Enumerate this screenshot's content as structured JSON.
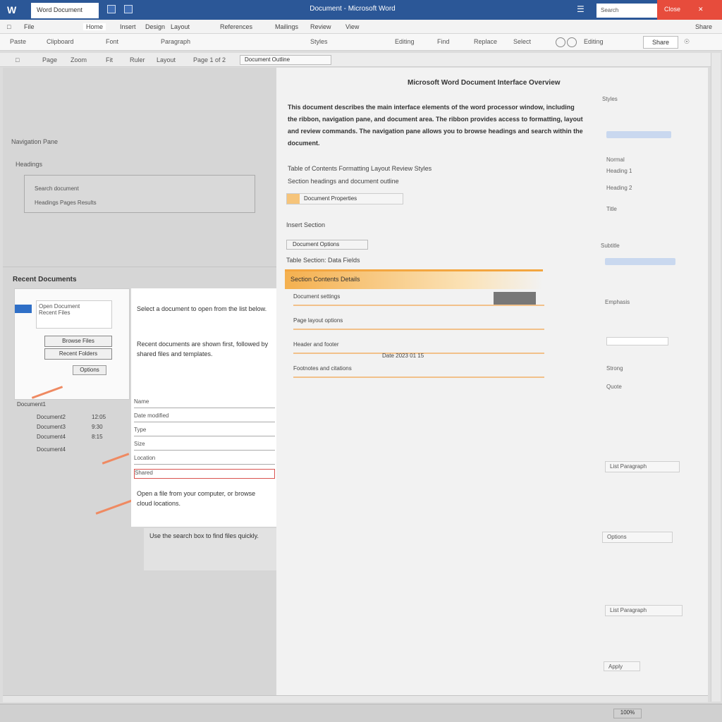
{
  "window": {
    "app_icon": "word-logo-icon",
    "doc_tab": "Word Document",
    "title": "Document - Microsoft Word",
    "search_placeholder": "Search",
    "close_label": "Close"
  },
  "menubar": {
    "file": "File",
    "items": [
      "Home",
      "Insert",
      "Design",
      "Layout",
      "References",
      "Mailings",
      "Review",
      "View"
    ],
    "right_label": "Share"
  },
  "toolbar": {
    "labels": [
      "Paste",
      "Clipboard",
      "Font",
      "Paragraph",
      "Styles",
      "Editing",
      "Find",
      "Replace",
      "Select"
    ],
    "share_button": "Share"
  },
  "subbar": {
    "items": [
      "Page",
      "Zoom",
      "Fit",
      "Ruler",
      "Layout",
      "Page 1 of 2"
    ],
    "field_value": "Document Outline"
  },
  "leftpane": {
    "label1": "Navigation Pane",
    "label2": "Headings",
    "box_rows": [
      "Search document",
      "Headings Pages Results"
    ]
  },
  "left_lower": {
    "heading": "Recent Documents",
    "dialog_text": [
      "Open Document",
      "Recent Files"
    ],
    "dialog_buttons": [
      "Browse Files",
      "Recent Folders",
      "Options"
    ],
    "list_items": [
      "Document1",
      "Document2",
      "Document3",
      "Document4"
    ],
    "list_values": [
      "12:05",
      "9:30",
      "8:15"
    ],
    "doc_paragraphs": [
      "Select a document to open from the list below.",
      "Recent documents are shown first, followed by shared files and templates.",
      "Open a file from your computer, or browse cloud locations.",
      "Use the search box to find files quickly."
    ],
    "doc_rows": [
      "Name",
      "Date modified",
      "Type",
      "Size",
      "Location",
      "Shared"
    ]
  },
  "document": {
    "page_title": "Microsoft Word Document Interface Overview",
    "paragraph": "This document describes the main interface elements of the word processor window, including the ribbon, navigation pane, and document area. The ribbon provides access to formatting, layout and review commands. The navigation pane allows you to browse headings and search within the document.",
    "line1": "Table of Contents    Formatting    Layout    Review    Styles",
    "line2": "Section headings and document outline",
    "tag": "Document Properties",
    "subheading": "Insert Section",
    "smallbox": "Document Options",
    "line3": "Table Section: Data Fields",
    "section_head": "Section   Contents   Details",
    "rows": [
      "Document settings",
      "Page layout options",
      "Header and footer",
      "Date 2023 01 15",
      "Footnotes and citations"
    ]
  },
  "rightpanel": {
    "labels": [
      "Styles",
      "Normal",
      "Heading 1",
      "Heading 2",
      "Title",
      "Subtitle",
      "Emphasis",
      "Strong",
      "Quote",
      "List Paragraph",
      "Options",
      "Apply"
    ]
  },
  "statusbar": {
    "zoom": "100%"
  }
}
